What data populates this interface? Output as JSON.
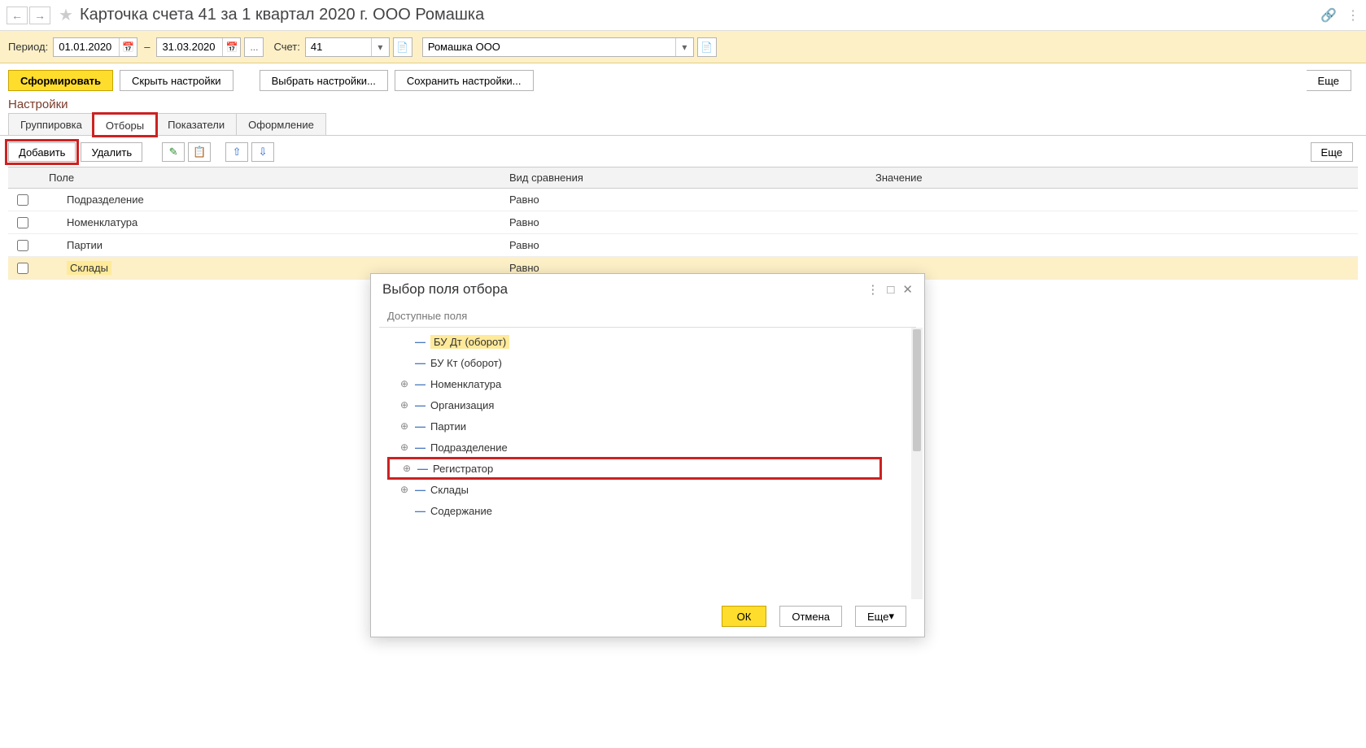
{
  "title": "Карточка счета 41 за 1 квартал 2020 г. ООО Ромашка",
  "filter": {
    "period_label": "Период:",
    "date_from": "01.01.2020",
    "date_to": "31.03.2020",
    "ellipsis": "...",
    "account_label": "Счет:",
    "account_value": "41",
    "org_value": "Ромашка ООО",
    "dash": "–"
  },
  "toolbar": {
    "form": "Сформировать",
    "hide_settings": "Скрыть настройки",
    "choose_settings": "Выбрать настройки...",
    "save_settings": "Сохранить настройки...",
    "more": "Еще"
  },
  "settings_label": "Настройки",
  "tabs": {
    "grouping": "Группировка",
    "filters": "Отборы",
    "indicators": "Показатели",
    "format": "Оформление"
  },
  "grid_toolbar": {
    "add": "Добавить",
    "delete": "Удалить",
    "more": "Еще"
  },
  "grid_head": {
    "field": "Поле",
    "compare": "Вид сравнения",
    "value": "Значение"
  },
  "rows": [
    {
      "field": "Подразделение",
      "compare": "Равно"
    },
    {
      "field": "Номенклатура",
      "compare": "Равно"
    },
    {
      "field": "Партии",
      "compare": "Равно"
    },
    {
      "field": "Склады",
      "compare": "Равно"
    }
  ],
  "popup": {
    "title": "Выбор поля отбора",
    "available": "Доступные поля",
    "ok": "ОК",
    "cancel": "Отмена",
    "more": "Еще",
    "items": [
      {
        "label": "БУ Дт (оборот)",
        "exp": false,
        "hl": true
      },
      {
        "label": "БУ Кт (оборот)",
        "exp": false
      },
      {
        "label": "Номенклатура",
        "exp": true
      },
      {
        "label": "Организация",
        "exp": true
      },
      {
        "label": "Партии",
        "exp": true
      },
      {
        "label": "Подразделение",
        "exp": true
      },
      {
        "label": "Регистратор",
        "exp": true,
        "red": true
      },
      {
        "label": "Склады",
        "exp": true
      },
      {
        "label": "Содержание",
        "exp": false
      }
    ]
  }
}
